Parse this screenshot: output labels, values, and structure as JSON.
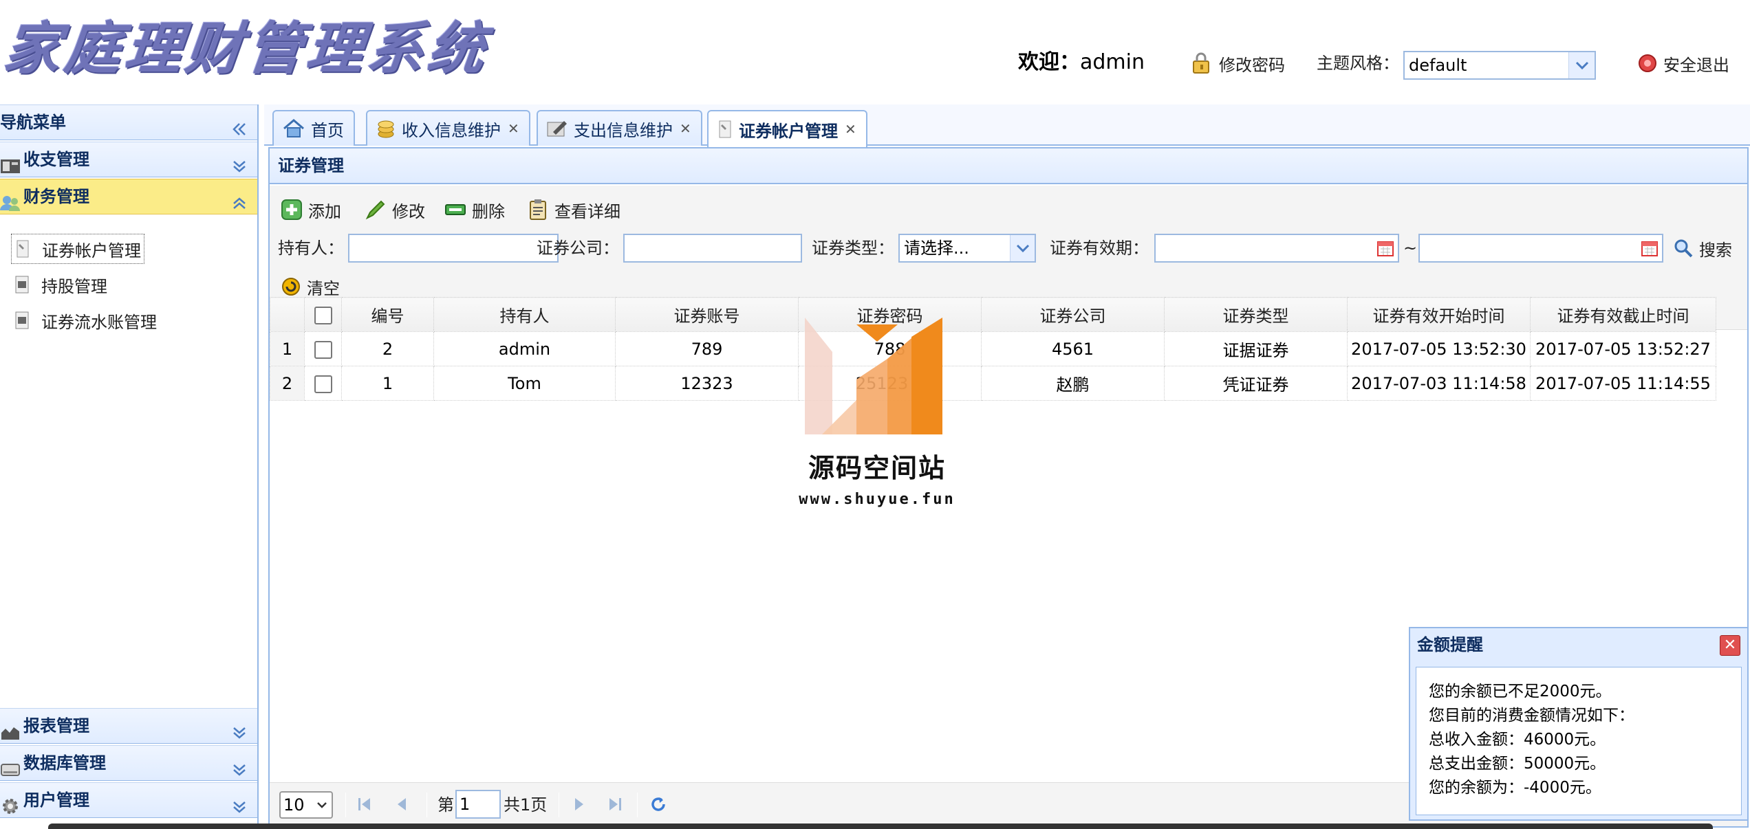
{
  "header": {
    "logo_text": "家庭理财管理系统",
    "welcome_label": "欢迎：",
    "username": "admin",
    "change_password": "修改密码",
    "theme_label": "主题风格：",
    "theme_value": "default",
    "logout": "安全退出"
  },
  "nav": {
    "title": "导航菜单",
    "groups": [
      {
        "label": "收支管理"
      },
      {
        "label": "财务管理"
      },
      {
        "label": "报表管理"
      },
      {
        "label": "数据库管理"
      },
      {
        "label": "用户管理"
      }
    ],
    "items": [
      {
        "label": "证券帐户管理"
      },
      {
        "label": "持股管理"
      },
      {
        "label": "证券流水账管理"
      }
    ]
  },
  "tabs": [
    {
      "label": "首页"
    },
    {
      "label": "收入信息维护"
    },
    {
      "label": "支出信息维护"
    },
    {
      "label": "证券帐户管理"
    }
  ],
  "content": {
    "title": "证券管理",
    "toolbar": {
      "add": "添加",
      "edit": "修改",
      "delete": "删除",
      "detail": "查看详细",
      "clear": "清空",
      "search": "搜索"
    },
    "filters": {
      "holder_label": "持有人：",
      "holder_value": "",
      "company_label": "证券公司：",
      "company_value": "",
      "type_label": "证券类型：",
      "type_value": "请选择...",
      "valid_label": "证券有效期：",
      "date_sep": "~"
    },
    "grid": {
      "columns": [
        "编号",
        "持有人",
        "证券账号",
        "证券密码",
        "证券公司",
        "证券类型",
        "证券有效开始时间",
        "证券有效截止时间"
      ],
      "rows": [
        {
          "rownum": "1",
          "id": "2",
          "holder": "admin",
          "account": "789",
          "password": "788",
          "company": "4561",
          "type": "证据证券",
          "start": "2017-07-05 13:52:30",
          "end": "2017-07-05 13:52:27"
        },
        {
          "rownum": "2",
          "id": "1",
          "holder": "Tom",
          "account": "12323",
          "password": "25123 8",
          "company": "赵鹏",
          "type": "凭证证券",
          "start": "2017-07-03 11:14:58",
          "end": "2017-07-05 11:14:55"
        }
      ]
    },
    "pager": {
      "page_size": "10",
      "page_prefix": "第",
      "page_value": "1",
      "page_total": "共1页"
    }
  },
  "watermark": {
    "title": "源码空间站",
    "url": "www.shuyue.fun"
  },
  "alert": {
    "title": "金额提醒",
    "lines": [
      "您的余额已不足2000元。",
      "您目前的消费金额情况如下：",
      "总收入金额：46000元。",
      "总支出金额：50000元。",
      "您的余额为：-4000元。"
    ]
  },
  "colors": {
    "panel_border": "#95b8e7",
    "active_group": "#fbec88",
    "logo": "#6f73b8",
    "watermark_orange": "#f08a1c"
  }
}
